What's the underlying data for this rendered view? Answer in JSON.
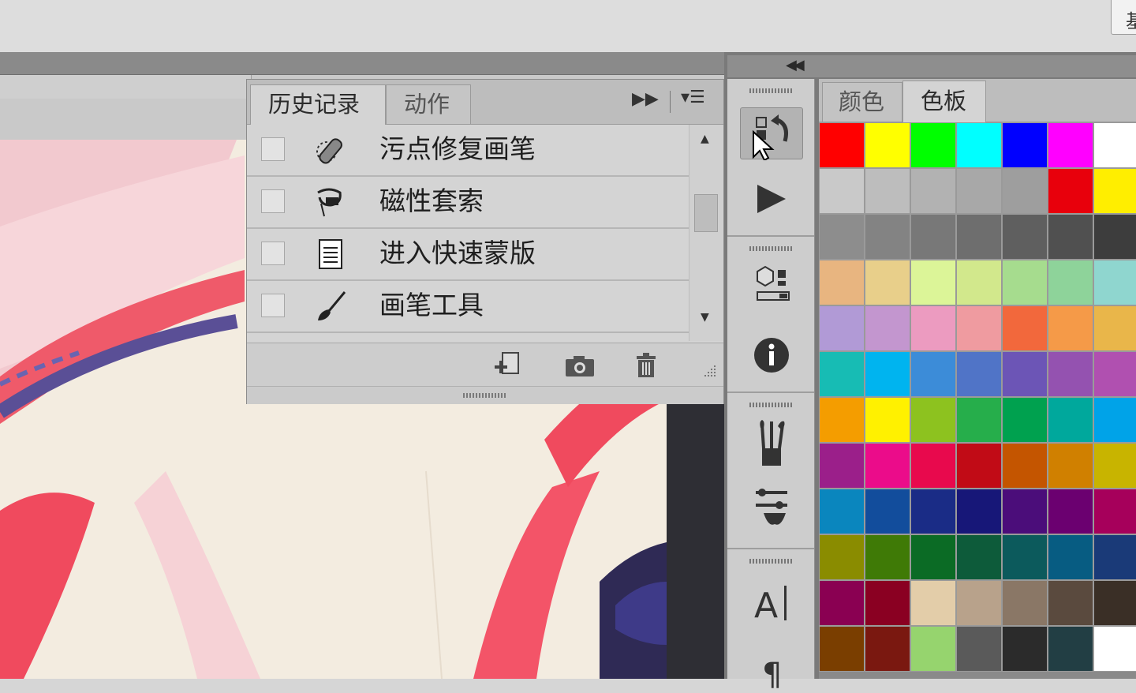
{
  "app": {
    "top_right_glyph": "基"
  },
  "history_panel": {
    "tabs": [
      {
        "label": "历史记录",
        "active": true
      },
      {
        "label": "动作",
        "active": false
      }
    ],
    "controls": {
      "expand_icon": "double-arrow-right-icon",
      "menu_icon": "panel-menu-icon"
    },
    "items": [
      {
        "label": "污点修复画笔",
        "icon": "spot-healing-brush-icon",
        "checked": false
      },
      {
        "label": "磁性套索",
        "icon": "magnetic-lasso-icon",
        "checked": false
      },
      {
        "label": "进入快速蒙版",
        "icon": "quick-mask-document-icon",
        "checked": false
      },
      {
        "label": "画笔工具",
        "icon": "brush-icon",
        "checked": false
      }
    ],
    "footer_buttons": [
      {
        "name": "new-document-from-state-button",
        "icon": "new-document-icon"
      },
      {
        "name": "new-snapshot-button",
        "icon": "camera-icon"
      },
      {
        "name": "delete-state-button",
        "icon": "trash-icon"
      }
    ]
  },
  "dock": {
    "collapse_icon": "double-arrow-left-icon",
    "groups": [
      {
        "buttons": [
          {
            "name": "history-panel-button",
            "icon": "history-icon",
            "active": true
          },
          {
            "name": "actions-panel-button",
            "icon": "play-icon",
            "active": false
          }
        ]
      },
      {
        "buttons": [
          {
            "name": "3d-panel-button",
            "icon": "3d-cube-icon",
            "active": false
          },
          {
            "name": "info-panel-button",
            "icon": "info-icon",
            "active": false
          }
        ]
      },
      {
        "buttons": [
          {
            "name": "brush-presets-button",
            "icon": "brush-presets-icon",
            "active": false
          },
          {
            "name": "brush-settings-button",
            "icon": "brush-settings-icon",
            "active": false
          }
        ]
      },
      {
        "buttons": [
          {
            "name": "character-panel-button",
            "icon": "character-icon",
            "active": false
          },
          {
            "name": "paragraph-panel-button",
            "icon": "paragraph-icon",
            "active": false
          }
        ]
      }
    ]
  },
  "swatch_panel": {
    "tabs": [
      {
        "label": "颜色",
        "active": false
      },
      {
        "label": "色板",
        "active": true
      }
    ],
    "swatches": [
      "#ff0000",
      "#ffff00",
      "#00ff00",
      "#00ffff",
      "#0000ff",
      "#ff00ff",
      "#ffffff",
      "#c9c9c9",
      "#bdbdbd",
      "#b2b2b2",
      "#a8a8a8",
      "#9e9e9e",
      "#e8000c",
      "#ffee00",
      "#8d8d8d",
      "#838383",
      "#787878",
      "#6e6e6e",
      "#5f5f5f",
      "#505050",
      "#3d3d3d",
      "#e8b580",
      "#e8cf8a",
      "#dcf598",
      "#d2e88c",
      "#a6dc8e",
      "#8ed39a",
      "#8fd6cf",
      "#b19ad6",
      "#c396cf",
      "#ec9bc0",
      "#ef9ba0",
      "#f2683c",
      "#f59a48",
      "#e9b64a",
      "#17bcb4",
      "#00b4ef",
      "#3c8cd8",
      "#5074c7",
      "#6c55b6",
      "#9452b0",
      "#b050b0",
      "#f49d00",
      "#fff100",
      "#8dc21f",
      "#26ae4b",
      "#00a14f",
      "#00a89c",
      "#00a3e8",
      "#9b1f8a",
      "#eb0c8a",
      "#e8094d",
      "#c10b16",
      "#c45500",
      "#d08000",
      "#c8b400",
      "#0a86be",
      "#124d9c",
      "#1a2c86",
      "#171778",
      "#4b0d7a",
      "#6b0070",
      "#a6005b",
      "#8a8c00",
      "#3f7a06",
      "#0b6b25",
      "#0d5b3a",
      "#0c5a5c",
      "#075c82",
      "#1a3a78",
      "#8a0052",
      "#8a0022",
      "#e3cda9",
      "#b8a28b",
      "#8a7766",
      "#5a4a3e",
      "#3a2f26",
      "#7a3e00",
      "#7a1810",
      "#96d46e",
      "#5a5a5a",
      "#2b2b2b",
      "#223e44",
      "#ffffff"
    ]
  }
}
